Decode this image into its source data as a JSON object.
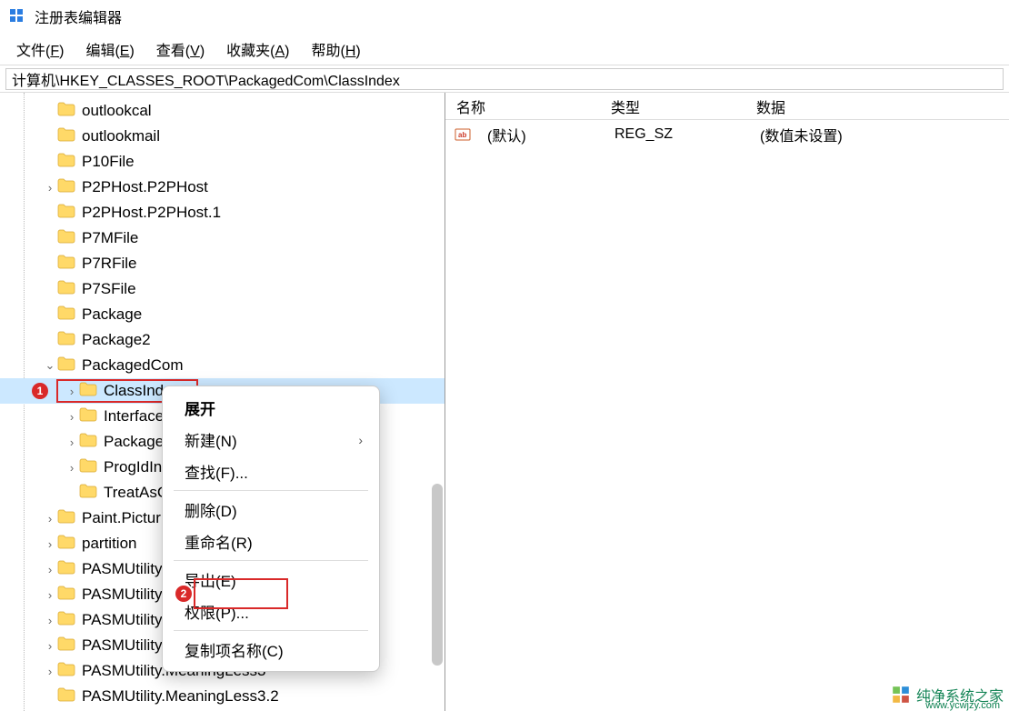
{
  "window": {
    "title": "注册表编辑器"
  },
  "menu": {
    "file": {
      "label": "文件(",
      "accel": "F",
      "suffix": ")"
    },
    "edit": {
      "label": "编辑(",
      "accel": "E",
      "suffix": ")"
    },
    "view": {
      "label": "查看(",
      "accel": "V",
      "suffix": ")"
    },
    "fav": {
      "label": "收藏夹(",
      "accel": "A",
      "suffix": ")"
    },
    "help": {
      "label": "帮助(",
      "accel": "H",
      "suffix": ")"
    }
  },
  "address": {
    "value": "计算机\\HKEY_CLASSES_ROOT\\PackagedCom\\ClassIndex"
  },
  "tree": {
    "items": [
      {
        "label": "outlookcal",
        "expander": "none",
        "indent": 1
      },
      {
        "label": "outlookmail",
        "expander": "none",
        "indent": 1
      },
      {
        "label": "P10File",
        "expander": "none",
        "indent": 1
      },
      {
        "label": "P2PHost.P2PHost",
        "expander": "closed",
        "indent": 1
      },
      {
        "label": "P2PHost.P2PHost.1",
        "expander": "none",
        "indent": 1
      },
      {
        "label": "P7MFile",
        "expander": "none",
        "indent": 1
      },
      {
        "label": "P7RFile",
        "expander": "none",
        "indent": 1
      },
      {
        "label": "P7SFile",
        "expander": "none",
        "indent": 1
      },
      {
        "label": "Package",
        "expander": "none",
        "indent": 1
      },
      {
        "label": "Package2",
        "expander": "none",
        "indent": 1
      },
      {
        "label": "PackagedCom",
        "expander": "open",
        "indent": 1
      },
      {
        "label": "ClassInd",
        "expander": "closed",
        "indent": 2,
        "selected": true
      },
      {
        "label": "Interface",
        "expander": "closed",
        "indent": 2
      },
      {
        "label": "Package",
        "expander": "closed",
        "indent": 2
      },
      {
        "label": "ProgIdIn",
        "expander": "closed",
        "indent": 2
      },
      {
        "label": "TreatAsC",
        "expander": "none",
        "indent": 2
      },
      {
        "label": "Paint.Pictur",
        "expander": "closed",
        "indent": 1
      },
      {
        "label": "partition",
        "expander": "closed",
        "indent": 1
      },
      {
        "label": "PASMUtility",
        "expander": "closed",
        "indent": 1
      },
      {
        "label": "PASMUtility",
        "expander": "closed",
        "indent": 1
      },
      {
        "label": "PASMUtility",
        "expander": "closed",
        "indent": 1
      },
      {
        "label": "PASMUtility",
        "expander": "closed",
        "indent": 1
      },
      {
        "label": "PASMUtility.MeaningLess3",
        "expander": "closed",
        "indent": 1
      },
      {
        "label": "PASMUtility.MeaningLess3.2",
        "expander": "none",
        "indent": 1
      }
    ]
  },
  "context_menu": {
    "expand": "展开",
    "new": "新建(N)",
    "find": "查找(F)...",
    "delete": "删除(D)",
    "rename": "重命名(R)",
    "export": "导出(E)",
    "permissions": "权限(P)...",
    "copy_key_name": "复制项名称(C)"
  },
  "columns": {
    "name": "名称",
    "type": "类型",
    "data": "数据"
  },
  "values": [
    {
      "name": "(默认)",
      "type": "REG_SZ",
      "data": "(数值未设置)"
    }
  ],
  "watermark": {
    "text": "纯净系统之家",
    "url": "www.ycwjzy.com"
  }
}
